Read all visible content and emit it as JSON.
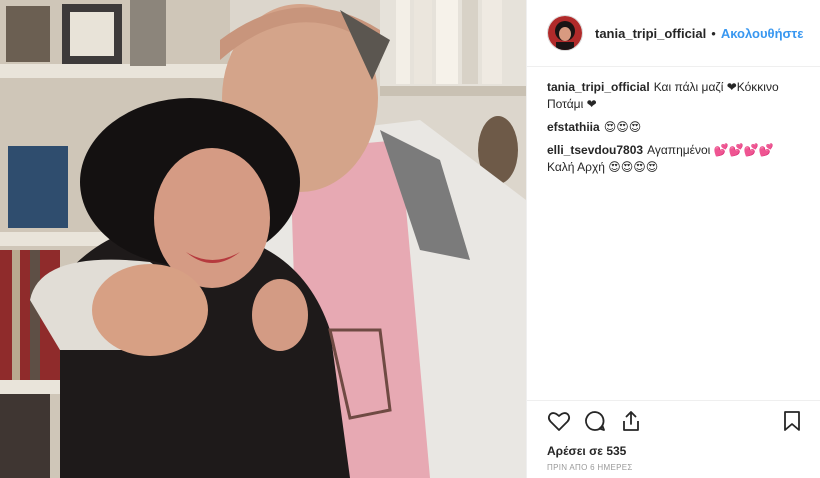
{
  "post": {
    "author": "tania_tripi_official",
    "follow_label": "Ακολουθήστε",
    "separator": "•",
    "comments": [
      {
        "user": "tania_tripi_official",
        "text": "Και πάλι μαζί ❤Κόκκινο Ποτάμι ❤"
      },
      {
        "user": "efstathiia",
        "text": "😍😍😍"
      },
      {
        "user": "elli_tsevdou7803",
        "text": "Αγαπημένοι 💕💕💕💕 Καλή Αρχή 😍😍😍😍"
      }
    ],
    "likes": "Αρέσει σε 535",
    "timestamp": "ΠΡΙΝ ΑΠΟ 6 ΗΜΕΡΕΣ"
  },
  "icons": {
    "like": "heart-icon",
    "comment": "comment-icon",
    "share": "share-icon",
    "save": "bookmark-icon"
  },
  "colors": {
    "link": "#3897f0",
    "text": "#262626",
    "muted": "#999999"
  }
}
